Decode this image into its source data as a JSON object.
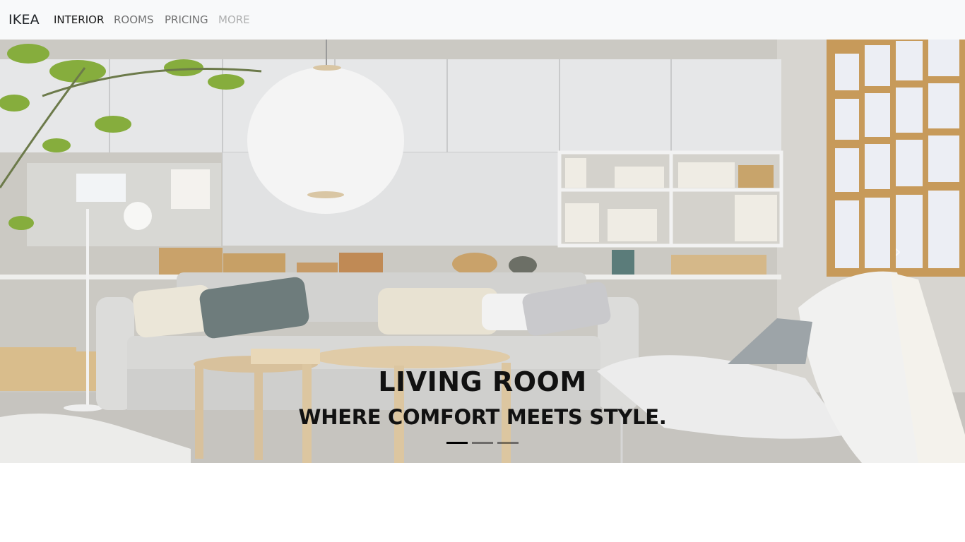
{
  "navbar": {
    "brand": "IKEA",
    "links": [
      {
        "label": "INTERIOR",
        "state": "active"
      },
      {
        "label": "ROOMS",
        "state": "normal"
      },
      {
        "label": "PRICING",
        "state": "normal"
      },
      {
        "label": "MORE",
        "state": "disabled"
      }
    ]
  },
  "carousel": {
    "title": "LIVING ROOM",
    "subtitle": "WHERE COMFORT MEETS STYLE.",
    "slide_count": 3,
    "active_slide": 1,
    "prev_icon": "chevron-left-icon",
    "next_icon": "chevron-right-icon",
    "next_glyph": "›"
  },
  "colors": {
    "navbar_bg": "#f8f9fa",
    "caption_text": "#111111",
    "wall": "#c9c7c1",
    "cabinet": "#e4e5e6",
    "sofa": "#d6d6d4",
    "wood": "#dcc8a2",
    "floor": "#c4c2bd"
  }
}
